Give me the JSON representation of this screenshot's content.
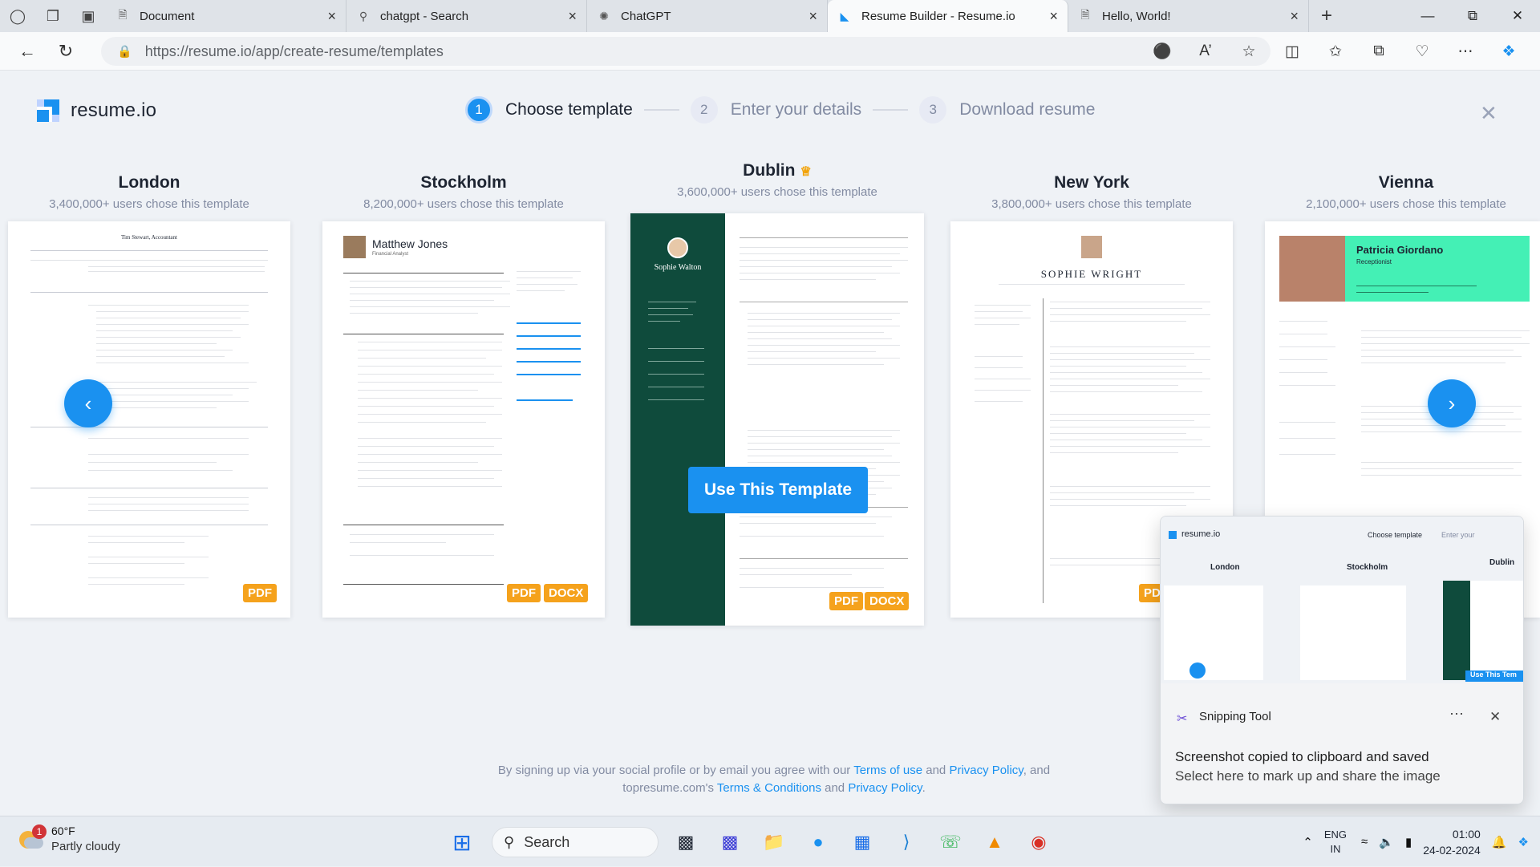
{
  "browser": {
    "tabs": [
      {
        "title": "Document",
        "icon": "document-icon"
      },
      {
        "title": "chatgpt - Search",
        "icon": "search-icon"
      },
      {
        "title": "ChatGPT",
        "icon": "chatgpt-icon"
      },
      {
        "title": "Resume Builder - Resume.io",
        "icon": "resumeio-icon",
        "active": true
      },
      {
        "title": "Hello, World!",
        "icon": "document-icon"
      }
    ],
    "url": "https://resume.io/app/create-resume/templates"
  },
  "app": {
    "logo_text": "resume.io",
    "steps": [
      {
        "num": "1",
        "label": "Choose template",
        "active": true
      },
      {
        "num": "2",
        "label": "Enter your details"
      },
      {
        "num": "3",
        "label": "Download resume"
      }
    ],
    "use_template": "Use This Template",
    "templates": [
      {
        "name": "London",
        "users": "3,400,000+ users chose this template",
        "formats": [
          "PDF"
        ]
      },
      {
        "name": "Stockholm",
        "users": "8,200,000+ users chose this template",
        "formats": [
          "PDF",
          "DOCX"
        ]
      },
      {
        "name": "Dublin",
        "users": "3,600,000+ users chose this template",
        "formats": [
          "PDF",
          "DOCX"
        ],
        "premium": true
      },
      {
        "name": "New York",
        "users": "3,800,000+ users chose this template",
        "formats": [
          "PDF"
        ]
      },
      {
        "name": "Vienna",
        "users": "2,100,000+ users chose this template",
        "formats": []
      }
    ],
    "preview_names": {
      "london": "Tim Stewart, Accountant",
      "stockholm": "Matthew Jones",
      "stockholm_role": "Financial Analyst",
      "dublin": "Sophie Walton",
      "newyork": "SOPHIE WRIGHT",
      "vienna": "Patricia Giordano",
      "vienna_role": "Receptionist"
    },
    "terms": {
      "prefix": "By signing up via your social profile or by email you agree with our ",
      "terms_link": "Terms of use",
      "and1": " and ",
      "privacy_link": "Privacy Policy",
      "mid": ", and topresume.com's ",
      "tc_link": "Terms & Conditions",
      "and2": " and ",
      "privacy2_link": "Privacy Policy",
      "end": "."
    }
  },
  "snipping": {
    "app_name": "Snipping Tool",
    "title": "Screenshot copied to clipboard and saved",
    "subtitle": "Select here to mark up and share the image",
    "thumb_logo": "resume.io",
    "thumb_step1": "Choose template",
    "thumb_step2": "Enter your",
    "thumb_names": [
      "London",
      "Stockholm",
      "Dublin"
    ],
    "thumb_use": "Use This Tem"
  },
  "taskbar": {
    "weather_temp": "60°F",
    "weather_desc": "Partly cloudy",
    "weather_badge": "1",
    "search": "Search",
    "lang1": "ENG",
    "lang2": "IN",
    "time": "01:00",
    "date": "24-02-2024"
  },
  "colors": {
    "accent": "#1a91f0",
    "badge": "#f5a21c",
    "dublin": "#0f4b3c",
    "vienna": "#44f0b5"
  }
}
